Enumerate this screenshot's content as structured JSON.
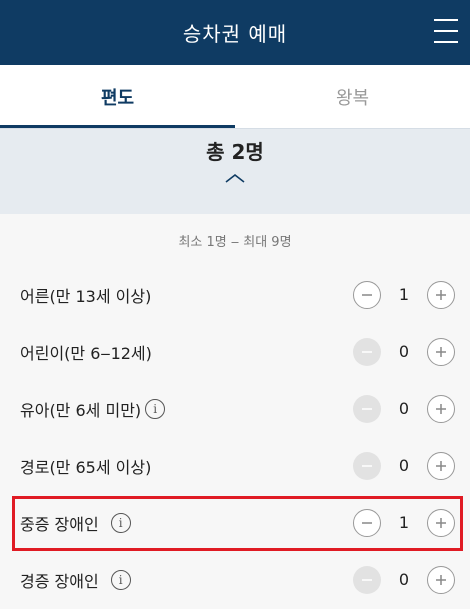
{
  "header": {
    "title": "승차권 예매",
    "menu_icon": "hamburger-menu-icon"
  },
  "tabs": [
    {
      "label": "편도",
      "active": true
    },
    {
      "label": "왕복",
      "active": false
    }
  ],
  "summary": {
    "total": "총 2명"
  },
  "limit_text": "최소 1명 ‒ 최대 9명",
  "passengers": [
    {
      "label": "어른(만 13세 이상)",
      "count": "1",
      "info": false,
      "minus_enabled": true
    },
    {
      "label": "어린이(만 6‒12세)",
      "count": "0",
      "info": false,
      "minus_enabled": false
    },
    {
      "label": "유아(만 6세 미만)",
      "count": "0",
      "info": true,
      "minus_enabled": false
    },
    {
      "label": "경로(만 65세 이상)",
      "count": "0",
      "info": false,
      "minus_enabled": false
    },
    {
      "label": "중증 장애인",
      "count": "1",
      "info": true,
      "minus_enabled": true,
      "highlighted": true
    },
    {
      "label": "경증 장애인",
      "count": "0",
      "info": true,
      "minus_enabled": false
    }
  ],
  "colors": {
    "header_bg": "#0f3b63",
    "highlight": "#e01b24"
  }
}
